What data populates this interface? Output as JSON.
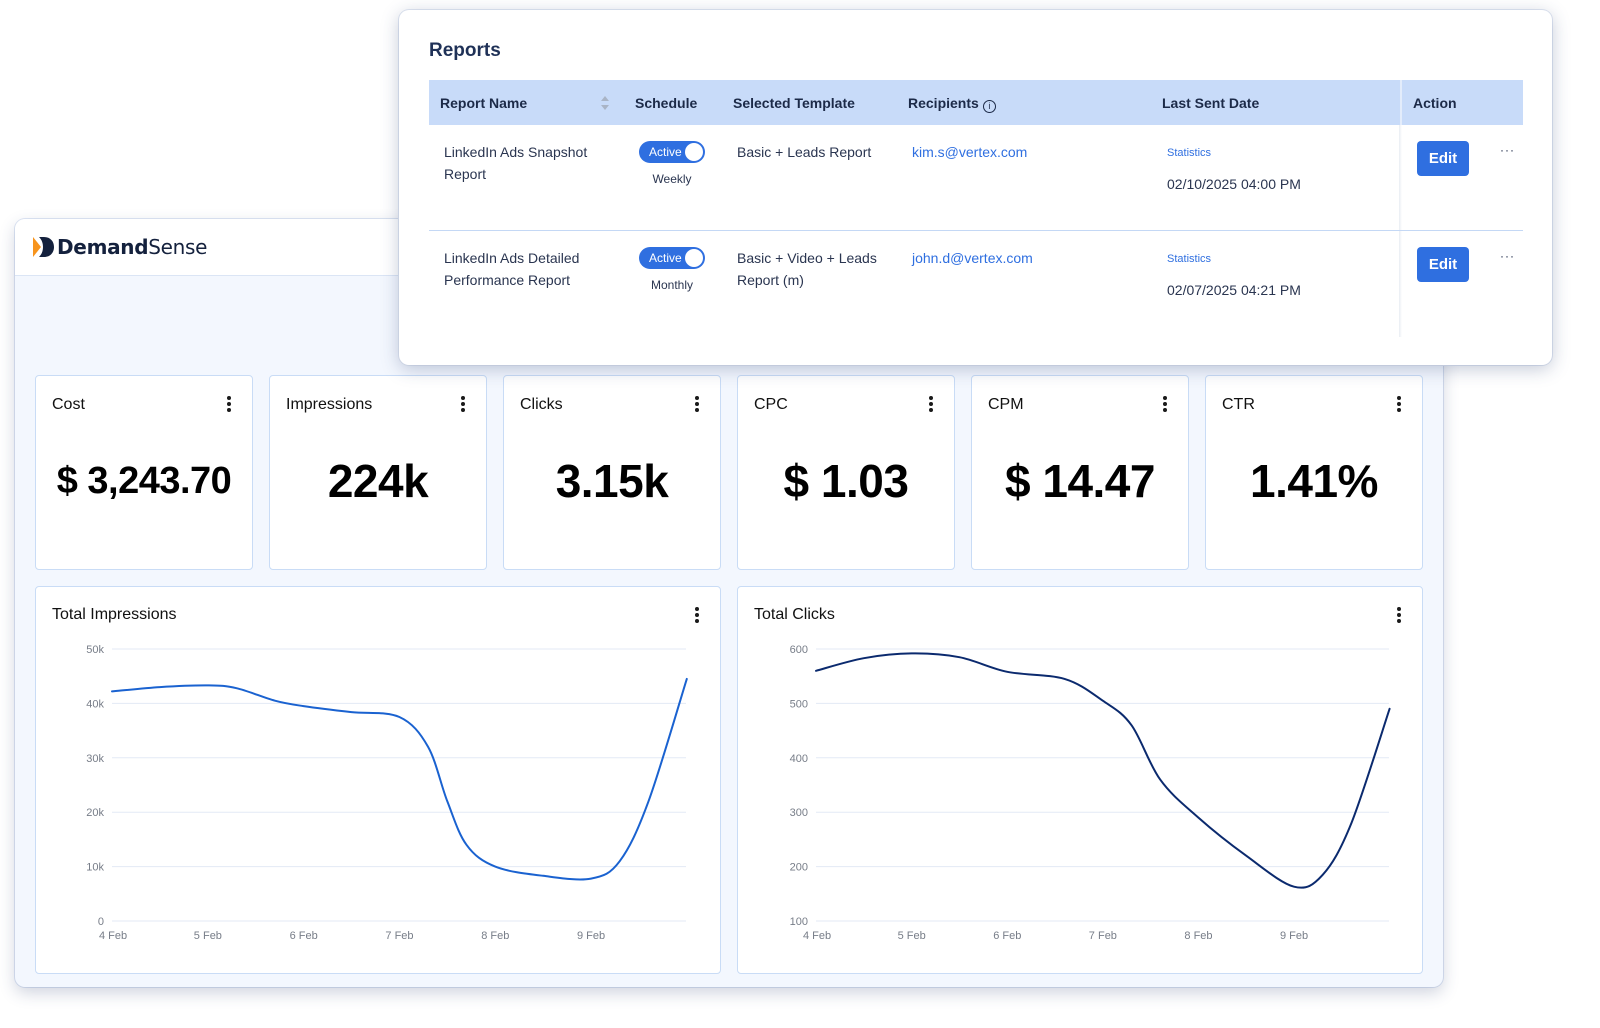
{
  "app": {
    "brand_bold": "Demand",
    "brand_light": "Sense",
    "brand_colors": {
      "primary": "#14213d",
      "accent": "#f7941d"
    }
  },
  "kpis": [
    {
      "title": "Cost",
      "value": "$ 3,243.70"
    },
    {
      "title": "Impressions",
      "value": "224k"
    },
    {
      "title": "Clicks",
      "value": "3.15k"
    },
    {
      "title": "CPC",
      "value": "$ 1.03"
    },
    {
      "title": "CPM",
      "value": "$ 14.47"
    },
    {
      "title": "CTR",
      "value": "1.41%"
    }
  ],
  "reports": {
    "title": "Reports",
    "columns": {
      "report_name": "Report Name",
      "schedule": "Schedule",
      "template": "Selected Template",
      "recipients": "Recipients",
      "last_sent": "Last Sent Date",
      "action": "Action"
    },
    "rows": [
      {
        "name_line1": "LinkedIn Ads Snapshot",
        "name_line2": "Report",
        "toggle_label": "Active",
        "toggle_on": true,
        "frequency": "Weekly",
        "template_line1": "Basic + Leads Report",
        "template_line2": "",
        "recipient": "kim.s@vertex.com",
        "stats_link": "Statistics",
        "last_sent": "02/10/2025 04:00 PM",
        "edit_label": "Edit",
        "more_label": "···"
      },
      {
        "name_line1": "LinkedIn Ads Detailed",
        "name_line2": "Performance Report",
        "toggle_label": "Active",
        "toggle_on": true,
        "frequency": "Monthly",
        "template_line1": "Basic + Video + Leads",
        "template_line2": "Report (m)",
        "recipient": "john.d@vertex.com",
        "stats_link": "Statistics",
        "last_sent": "02/07/2025 04:21 PM",
        "edit_label": "Edit",
        "more_label": "···"
      }
    ]
  },
  "chart_data": [
    {
      "type": "line",
      "title": "Total Impressions",
      "xlabel": "",
      "ylabel": "",
      "x_tick_labels": [
        "4 Feb",
        "5 Feb",
        "6 Feb",
        "7 Feb",
        "8 Feb",
        "9 Feb"
      ],
      "y_tick_labels": [
        "0",
        "10k",
        "20k",
        "30k",
        "40k",
        "50k"
      ],
      "y_ticks": [
        0,
        10000,
        20000,
        30000,
        40000,
        50000
      ],
      "ylim": [
        0,
        50000
      ],
      "xlim_days": [
        0,
        6
      ],
      "grid": true,
      "legend": "none",
      "color": "#1a62d0",
      "series": [
        {
          "name": "Impressions",
          "x_days": [
            0,
            0.5,
            1,
            1.3,
            1.7,
            2,
            2.5,
            3,
            3.3,
            3.5,
            3.7,
            4,
            4.5,
            5,
            5.3,
            5.6,
            6
          ],
          "values": [
            42200,
            43000,
            43300,
            42800,
            40500,
            39500,
            38400,
            37500,
            32000,
            22000,
            14000,
            10000,
            8300,
            7800,
            11000,
            22000,
            44500
          ]
        }
      ]
    },
    {
      "type": "line",
      "title": "Total Clicks",
      "xlabel": "",
      "ylabel": "",
      "x_tick_labels": [
        "4 Feb",
        "5 Feb",
        "6 Feb",
        "7 Feb",
        "8 Feb",
        "9 Feb"
      ],
      "y_tick_labels": [
        "100",
        "200",
        "300",
        "400",
        "500",
        "600"
      ],
      "y_ticks": [
        100,
        200,
        300,
        400,
        500,
        600
      ],
      "ylim": [
        100,
        600
      ],
      "xlim_days": [
        0,
        6
      ],
      "grid": true,
      "legend": "none",
      "color": "#0b2a6e",
      "series": [
        {
          "name": "Clicks",
          "x_days": [
            0,
            0.5,
            1,
            1.5,
            2,
            2.6,
            3,
            3.3,
            3.6,
            4,
            4.5,
            5,
            5.3,
            5.6,
            6
          ],
          "values": [
            560,
            583,
            592,
            585,
            558,
            545,
            505,
            460,
            360,
            290,
            220,
            163,
            185,
            280,
            490
          ]
        }
      ]
    }
  ]
}
